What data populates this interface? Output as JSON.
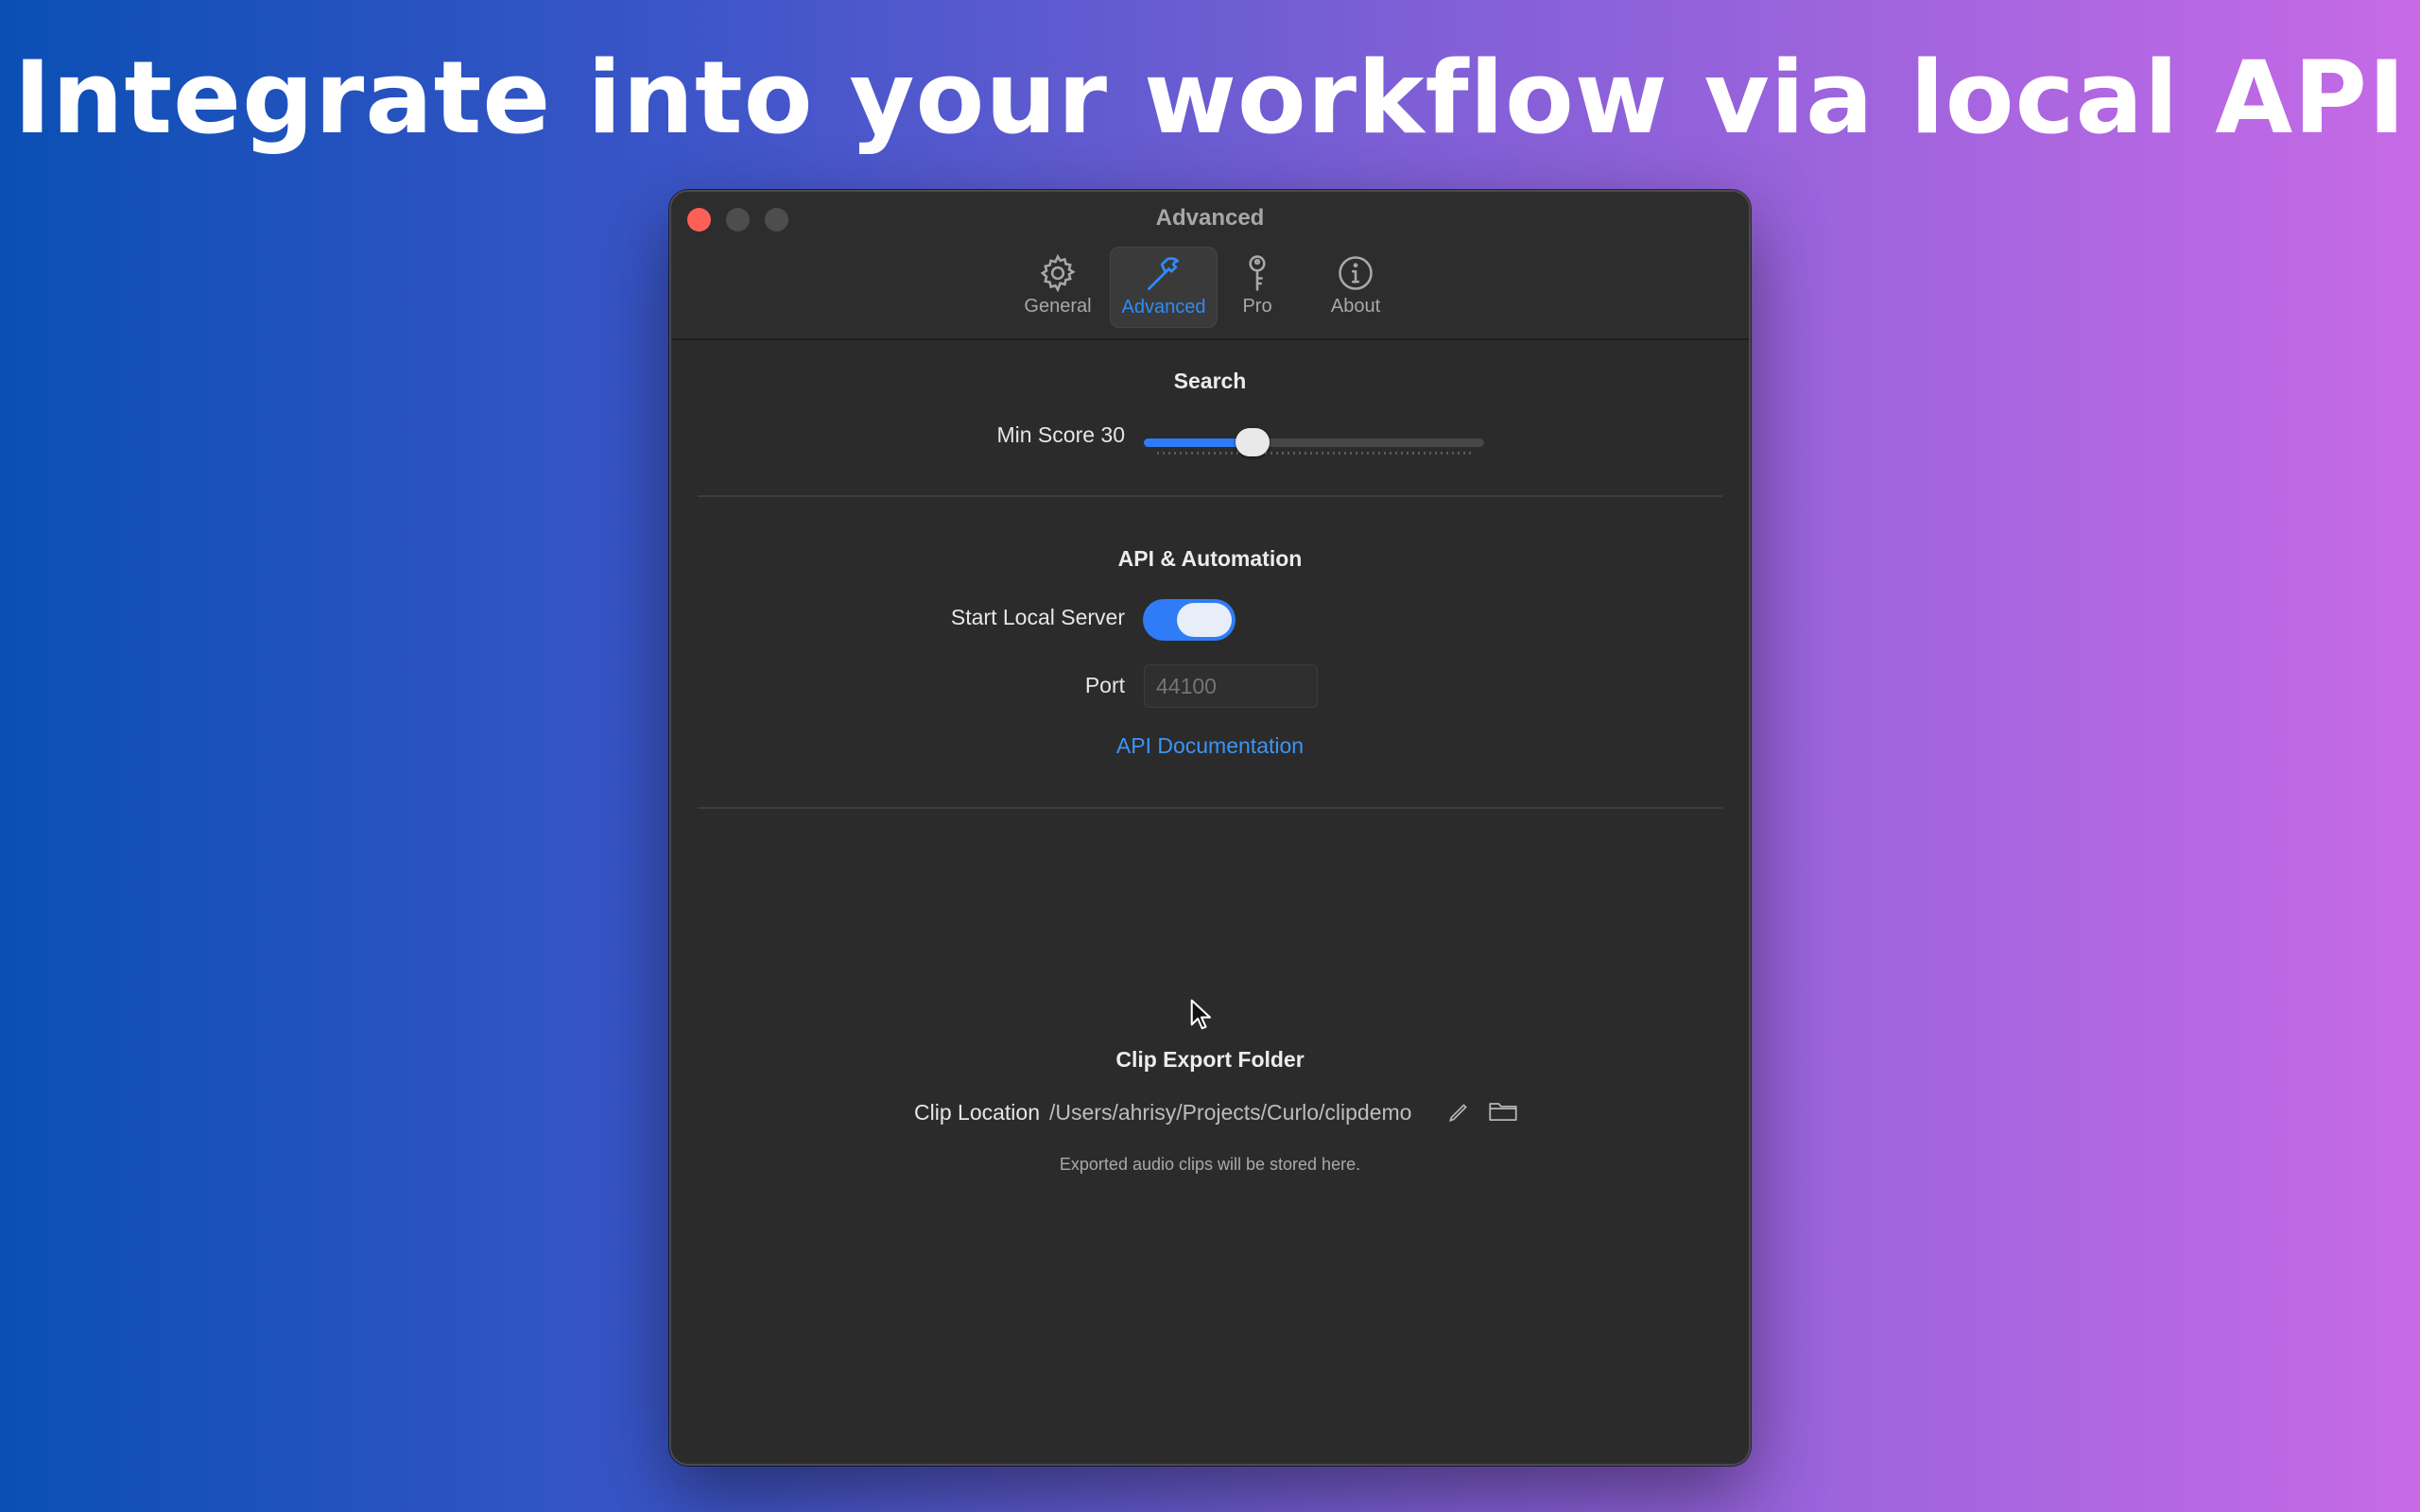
{
  "headline": "Integrate into your workflow via local API",
  "window": {
    "title": "Advanced",
    "tabs": [
      {
        "label": "General",
        "icon": "gear-icon",
        "active": false
      },
      {
        "label": "Advanced",
        "icon": "hammer-icon",
        "active": true
      },
      {
        "label": "Pro",
        "icon": "key-icon",
        "active": false
      },
      {
        "label": "About",
        "icon": "info-icon",
        "active": false
      }
    ]
  },
  "search": {
    "title": "Search",
    "min_score_label": "Min Score 30",
    "min_score_fraction": 0.32
  },
  "api": {
    "title": "API & Automation",
    "server_label": "Start Local Server",
    "server_on": true,
    "port_label": "Port",
    "port_placeholder": "44100",
    "docs_link": "API Documentation"
  },
  "clip_export": {
    "title": "Clip Export Folder",
    "location_label": "Clip Location",
    "location_path": "/Users/ahrisy/Projects/Curlo/clipdemo",
    "hint": "Exported audio clips will be stored here."
  },
  "colors": {
    "accent": "#2f7cf6",
    "link": "#3d94f6",
    "close_button": "#fe5f57"
  }
}
